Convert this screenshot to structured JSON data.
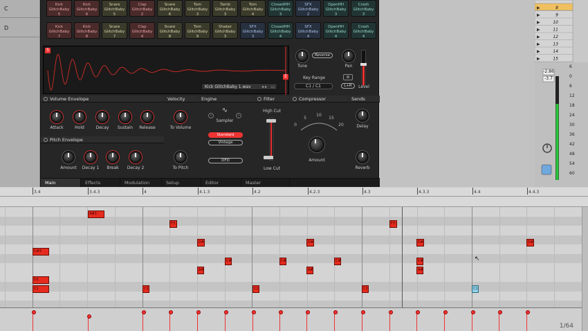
{
  "drum_rack": {
    "row_c": {
      "letter": "C",
      "pads": [
        {
          "l1": "Kick",
          "l2": "GlitchBaby 5",
          "color": "red"
        },
        {
          "l1": "Kick",
          "l2": "GlitchBaby 6",
          "color": "red"
        },
        {
          "l1": "Snare",
          "l2": "GlitchBaby 5",
          "color": "olive"
        },
        {
          "l1": "Clap",
          "l2": "GlitchBaby 2",
          "color": "red"
        },
        {
          "l1": "Snare",
          "l2": "GlitchBaby 6",
          "color": "olive"
        },
        {
          "l1": "Tom",
          "l2": "GlitchBaby 3",
          "color": "olive"
        },
        {
          "l1": "Tamb",
          "l2": "GlitchBaby 3",
          "color": "olive"
        },
        {
          "l1": "Tom",
          "l2": "GlitchBaby 4",
          "color": "olive"
        },
        {
          "l1": "ClosedHH",
          "l2": "GlitchBaby 3",
          "color": "teal"
        },
        {
          "l1": "SFX",
          "l2": "GlitchBaby 2",
          "color": "blue"
        },
        {
          "l1": "OpenHH",
          "l2": "GlitchBaby 3",
          "color": "teal"
        },
        {
          "l1": "Crash",
          "l2": "GlitchBaby 3",
          "color": "teal"
        }
      ]
    },
    "row_d": {
      "letter": "D",
      "pads": [
        {
          "l1": "Kick",
          "l2": "GlitchBaby 7",
          "color": "red"
        },
        {
          "l1": "Kick",
          "l2": "GlitchBaby 8",
          "color": "red"
        },
        {
          "l1": "Snare",
          "l2": "GlitchBaby 7",
          "color": "olive"
        },
        {
          "l1": "Clap",
          "l2": "GlitchBaby 4",
          "color": "red"
        },
        {
          "l1": "Snare",
          "l2": "GlitchBaby 8",
          "color": "olive"
        },
        {
          "l1": "Tom",
          "l2": "GlitchBaby 9",
          "color": "olive"
        },
        {
          "l1": "Shaker",
          "l2": "GlitchBaby 3",
          "color": "olive"
        },
        {
          "l1": "SFX",
          "l2": "GlitchBaby 3",
          "color": "blue"
        },
        {
          "l1": "ClosedHH",
          "l2": "GlitchBaby 4",
          "color": "teal"
        },
        {
          "l1": "SFX",
          "l2": "GlitchBaby 4",
          "color": "blue"
        },
        {
          "l1": "OpenHH",
          "l2": "GlitchBaby 4",
          "color": "teal"
        },
        {
          "l1": "Crash",
          "l2": "GlitchBaby 4",
          "color": "teal"
        }
      ]
    }
  },
  "sample": {
    "start_marker": "S",
    "end_marker": "E",
    "file_name": "Kick GlitchBaby 1.wav",
    "tune_label": "Tune",
    "reverse_label": "Reverse",
    "pan_label": "Pan",
    "key_range_label": "Key Range",
    "key_range_low": "C1",
    "key_range_sep": "/",
    "key_range_high": "C1",
    "level_label": "Level",
    "lr_label": "L+R"
  },
  "sections": {
    "volume_envelope": "Volume Envelope",
    "velocity": "Velocity",
    "engine": "Engine",
    "filter": "Filter",
    "compressor": "Compressor",
    "sends": "Sends",
    "pitch_envelope": "Pitch Envelope"
  },
  "knobs": {
    "attack": "Attack",
    "hold": "Hold",
    "decay": "Decay",
    "sustain": "Sustain",
    "release": "Release",
    "to_volume": "To Volume",
    "amount": "Amount",
    "decay1": "Decay 1",
    "brk": "Break",
    "decay2": "Decay 2",
    "to_pitch": "To Pitch",
    "high_cut": "High Cut",
    "low_cut": "Low Cut",
    "comp_amount": "Amount",
    "delay": "Delay",
    "reverb": "Reverb"
  },
  "engine": {
    "sampler_label": "Sampler",
    "standard": "Standard",
    "vintage": "Vintage",
    "dfd": "DFD"
  },
  "compressor_scale": [
    "0",
    "5",
    "10",
    "15",
    "20"
  ],
  "tabs": [
    "Main",
    "Effects",
    "Modulation",
    "Setup",
    "Editor",
    "Master"
  ],
  "mixer": {
    "rows": [
      "8",
      "9",
      "10",
      "11",
      "12",
      "13",
      "14",
      "15"
    ],
    "readout1": "-2.86",
    "readout2": "-3.7",
    "meter_scale": [
      "6",
      "0",
      "6",
      "12",
      "18",
      "24",
      "30",
      "36",
      "42",
      "48",
      "54",
      "60"
    ]
  },
  "ruler": {
    "labels": [
      "3.4",
      "3.4.3",
      "4",
      "4.1.3",
      "4.2",
      "4.2.3",
      "4.3",
      "4.3.3",
      "4.4",
      "4.4.3"
    ]
  },
  "notes": [
    {
      "label": "A#3"
    },
    {
      "label": "F3"
    },
    {
      "label": "F3"
    },
    {
      "label": "D#3"
    },
    {
      "label": "D#3"
    },
    {
      "label": "D#3"
    },
    {
      "label": "D#3"
    },
    {
      "label": "C#3"
    },
    {
      "label": "C#3"
    },
    {
      "label": "C#3"
    },
    {
      "label": "C#3"
    },
    {
      "label": "C#3"
    },
    {
      "label": "A#2"
    },
    {
      "label": "A#2"
    },
    {
      "label": "A#2"
    },
    {
      "label": "D1"
    },
    {
      "label": "C1"
    },
    {
      "label": "C1"
    },
    {
      "label": "C1"
    },
    {
      "label": "C1"
    },
    {
      "label": "C1"
    }
  ],
  "page_indicator": "1/64"
}
